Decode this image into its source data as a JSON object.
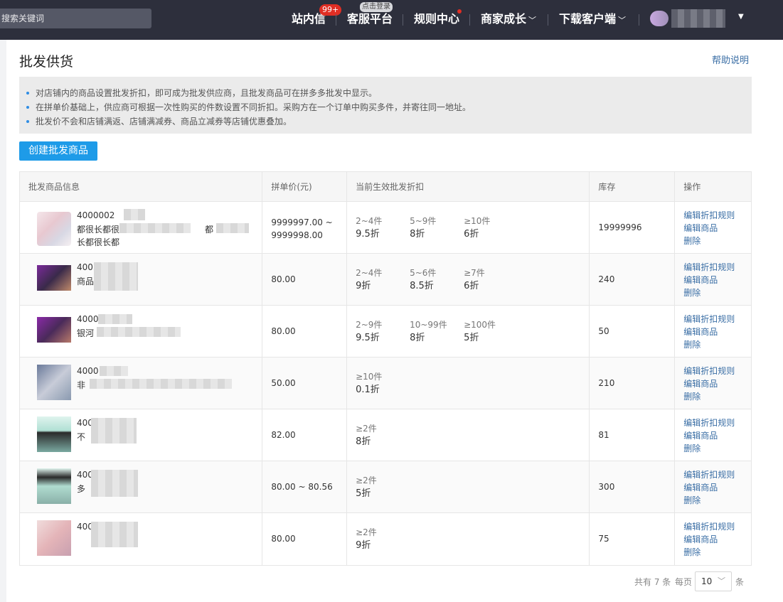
{
  "search": {
    "placeholder": "搜索关键词"
  },
  "nav": {
    "messages": "站内信",
    "messages_badge": "99+",
    "service": "客服平台",
    "service_tag": "点击登录",
    "rules": "规则中心",
    "growth": "商家成长",
    "download": "下载客户端"
  },
  "page": {
    "title": "批发供货",
    "help": "帮助说明",
    "notices": [
      "对店铺内的商品设置批发折扣，即可成为批发供应商，且批发商品可在拼多多批发中显示。",
      "在拼单价基础上，供应商可根据一次性购买的件数设置不同折扣。采购方在一个订单中购买多件，并寄往同一地址。",
      "批发价不会和店铺满返、店铺满减券、商品立减券等店铺优惠叠加。"
    ],
    "create_button": "创建批发商品"
  },
  "table": {
    "headers": [
      "批发商品信息",
      "拼单价(元)",
      "当前生效批发折扣",
      "库存",
      "操作"
    ],
    "ops": [
      "编辑折扣规则",
      "编辑商品",
      "删除"
    ],
    "rows": [
      {
        "id": "4000002",
        "name": "都很长都很",
        "name_tail": "都",
        "name2": "长都很长都",
        "price": "9999997.00 ~",
        "price2": "9999998.00",
        "tiers": [
          {
            "q": "2~4件",
            "d": "9.5折"
          },
          {
            "q": "5~9件",
            "d": "8折"
          },
          {
            "q": "≥10件",
            "d": "6折"
          }
        ],
        "stock": "19999996"
      },
      {
        "id": "400",
        "name": "商品",
        "price": "80.00",
        "tiers": [
          {
            "q": "2~4件",
            "d": "9折"
          },
          {
            "q": "5~6件",
            "d": "8.5折"
          },
          {
            "q": "≥7件",
            "d": "6折"
          }
        ],
        "stock": "240"
      },
      {
        "id": "4000",
        "name": "银河",
        "price": "80.00",
        "tiers": [
          {
            "q": "2~9件",
            "d": "9.5折"
          },
          {
            "q": "10~99件",
            "d": "8折"
          },
          {
            "q": "≥100件",
            "d": "5折"
          }
        ],
        "stock": "50"
      },
      {
        "id": "4000",
        "name": "非",
        "price": "50.00",
        "tiers": [
          {
            "q": "≥10件",
            "d": "0.1折"
          }
        ],
        "stock": "210"
      },
      {
        "id": "400",
        "name": "不",
        "price": "82.00",
        "tiers": [
          {
            "q": "≥2件",
            "d": "8折"
          }
        ],
        "stock": "81"
      },
      {
        "id": "400",
        "name": "多",
        "price": "80.00 ~ 80.56",
        "tiers": [
          {
            "q": "≥2件",
            "d": "5折"
          }
        ],
        "stock": "300"
      },
      {
        "id": "400",
        "name": "",
        "price": "80.00",
        "tiers": [
          {
            "q": "≥2件",
            "d": "9折"
          }
        ],
        "stock": "75"
      }
    ]
  },
  "pagination": {
    "total": "共有 7 条",
    "per_page_label": "每页",
    "per_page_value": "10",
    "unit": "条"
  },
  "colors": {
    "topbar": "#2d2f3c",
    "primary": "#1e9be8",
    "link": "#3a6ea5",
    "badge": "#e02e24"
  },
  "icons": {
    "chevron": "chevron-down-icon",
    "account_caret": "caret-down-icon"
  }
}
